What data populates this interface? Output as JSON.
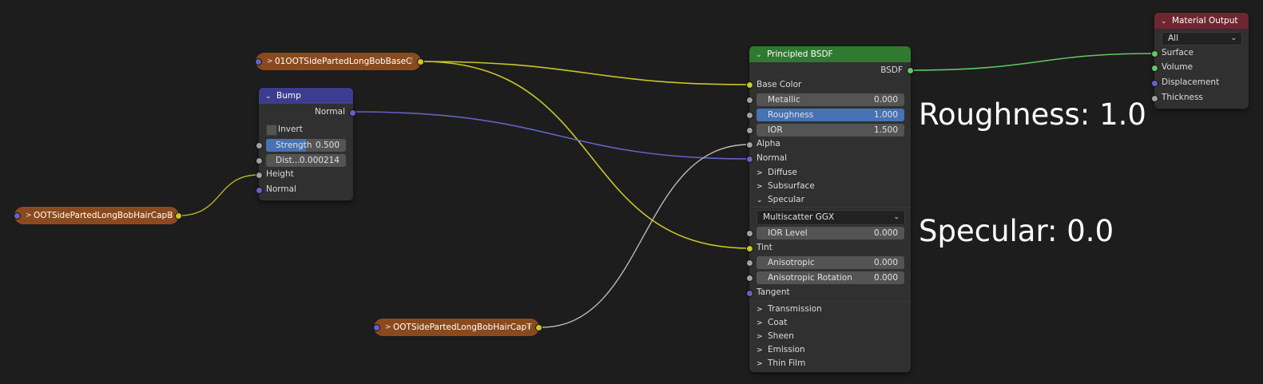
{
  "image_nodes": {
    "top": {
      "label": "01OOTSidePartedLongBobBaseC"
    },
    "left": {
      "label": "OOTSidePartedLongBobHairCapB"
    },
    "bottom": {
      "label": "OOTSidePartedLongBobHairCapT"
    },
    "grip": "⠿"
  },
  "bump": {
    "title": "Bump",
    "output_normal": "Normal",
    "invert": "Invert",
    "strength": {
      "label": "Strength",
      "value": "0.500",
      "fraction": 0.5
    },
    "distance": {
      "label": "Dist...",
      "value": "0.000214"
    },
    "height": "Height",
    "normal_in": "Normal"
  },
  "bsdf": {
    "title": "Principled BSDF",
    "output": "BSDF",
    "base_color": "Base Color",
    "metallic": {
      "label": "Metallic",
      "value": "0.000"
    },
    "roughness": {
      "label": "Roughness",
      "value": "1.000",
      "fraction": 1.0
    },
    "ior": {
      "label": "IOR",
      "value": "1.500"
    },
    "alpha": "Alpha",
    "normal": "Normal",
    "diffuse": "Diffuse",
    "subsurface": "Subsurface",
    "specular": "Specular",
    "distribution": "Multiscatter GGX",
    "ior_level": {
      "label": "IOR Level",
      "value": "0.000"
    },
    "tint": "Tint",
    "anisotropic": {
      "label": "Anisotropic",
      "value": "0.000"
    },
    "anisotropic_rotation": {
      "label": "Anisotropic Rotation",
      "value": "0.000"
    },
    "tangent": "Tangent",
    "transmission": "Transmission",
    "coat": "Coat",
    "sheen": "Sheen",
    "emission": "Emission",
    "thin_film": "Thin Film"
  },
  "material_output": {
    "title": "Material Output",
    "target": "All",
    "surface": "Surface",
    "volume": "Volume",
    "displacement": "Displacement",
    "thickness": "Thickness"
  },
  "annotations": {
    "roughness": "Roughness: 1.0",
    "specular": "Specular: 0.0"
  },
  "colors": {
    "socket_color": "#c7c729",
    "socket_float": "#a1a1a1",
    "socket_vector": "#6363c7",
    "socket_shader": "#63c763",
    "highlight": "#4772b3"
  }
}
